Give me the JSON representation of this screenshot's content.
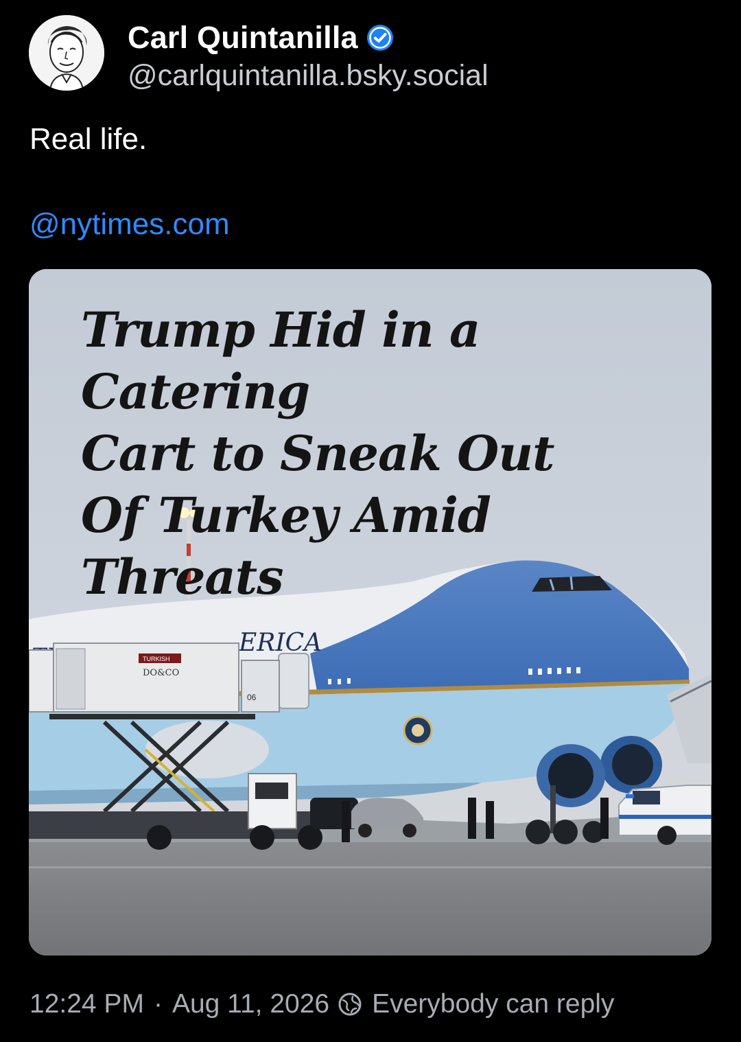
{
  "author": {
    "display_name": "Carl Quintanilla",
    "handle": "@carlquintanilla.bsky.social",
    "verified": true,
    "avatar_icon": "avatar-sketch-portrait"
  },
  "post": {
    "text": "Real life.",
    "mention": "@nytimes.com"
  },
  "embed": {
    "headline_lines": [
      "Trump Hid in a Catering",
      "Cart to Sneak Out",
      "Of Turkey Amid Threats"
    ],
    "image_texts": {
      "fuselage": "ERICA",
      "fuselage_left": "TE",
      "cart_brand_top": "TURKISH",
      "cart_brand": "DO&CO",
      "tail_number": "06"
    }
  },
  "footer": {
    "time": "12:24 PM",
    "separator": "·",
    "date": "Aug 11, 2026",
    "reply_setting": "Everybody can reply",
    "reply_icon": "globe-icon"
  },
  "colors": {
    "background": "#000000",
    "link": "#2f8bff",
    "verified": "#1d82f7",
    "secondary_text": "#a7adb4"
  }
}
